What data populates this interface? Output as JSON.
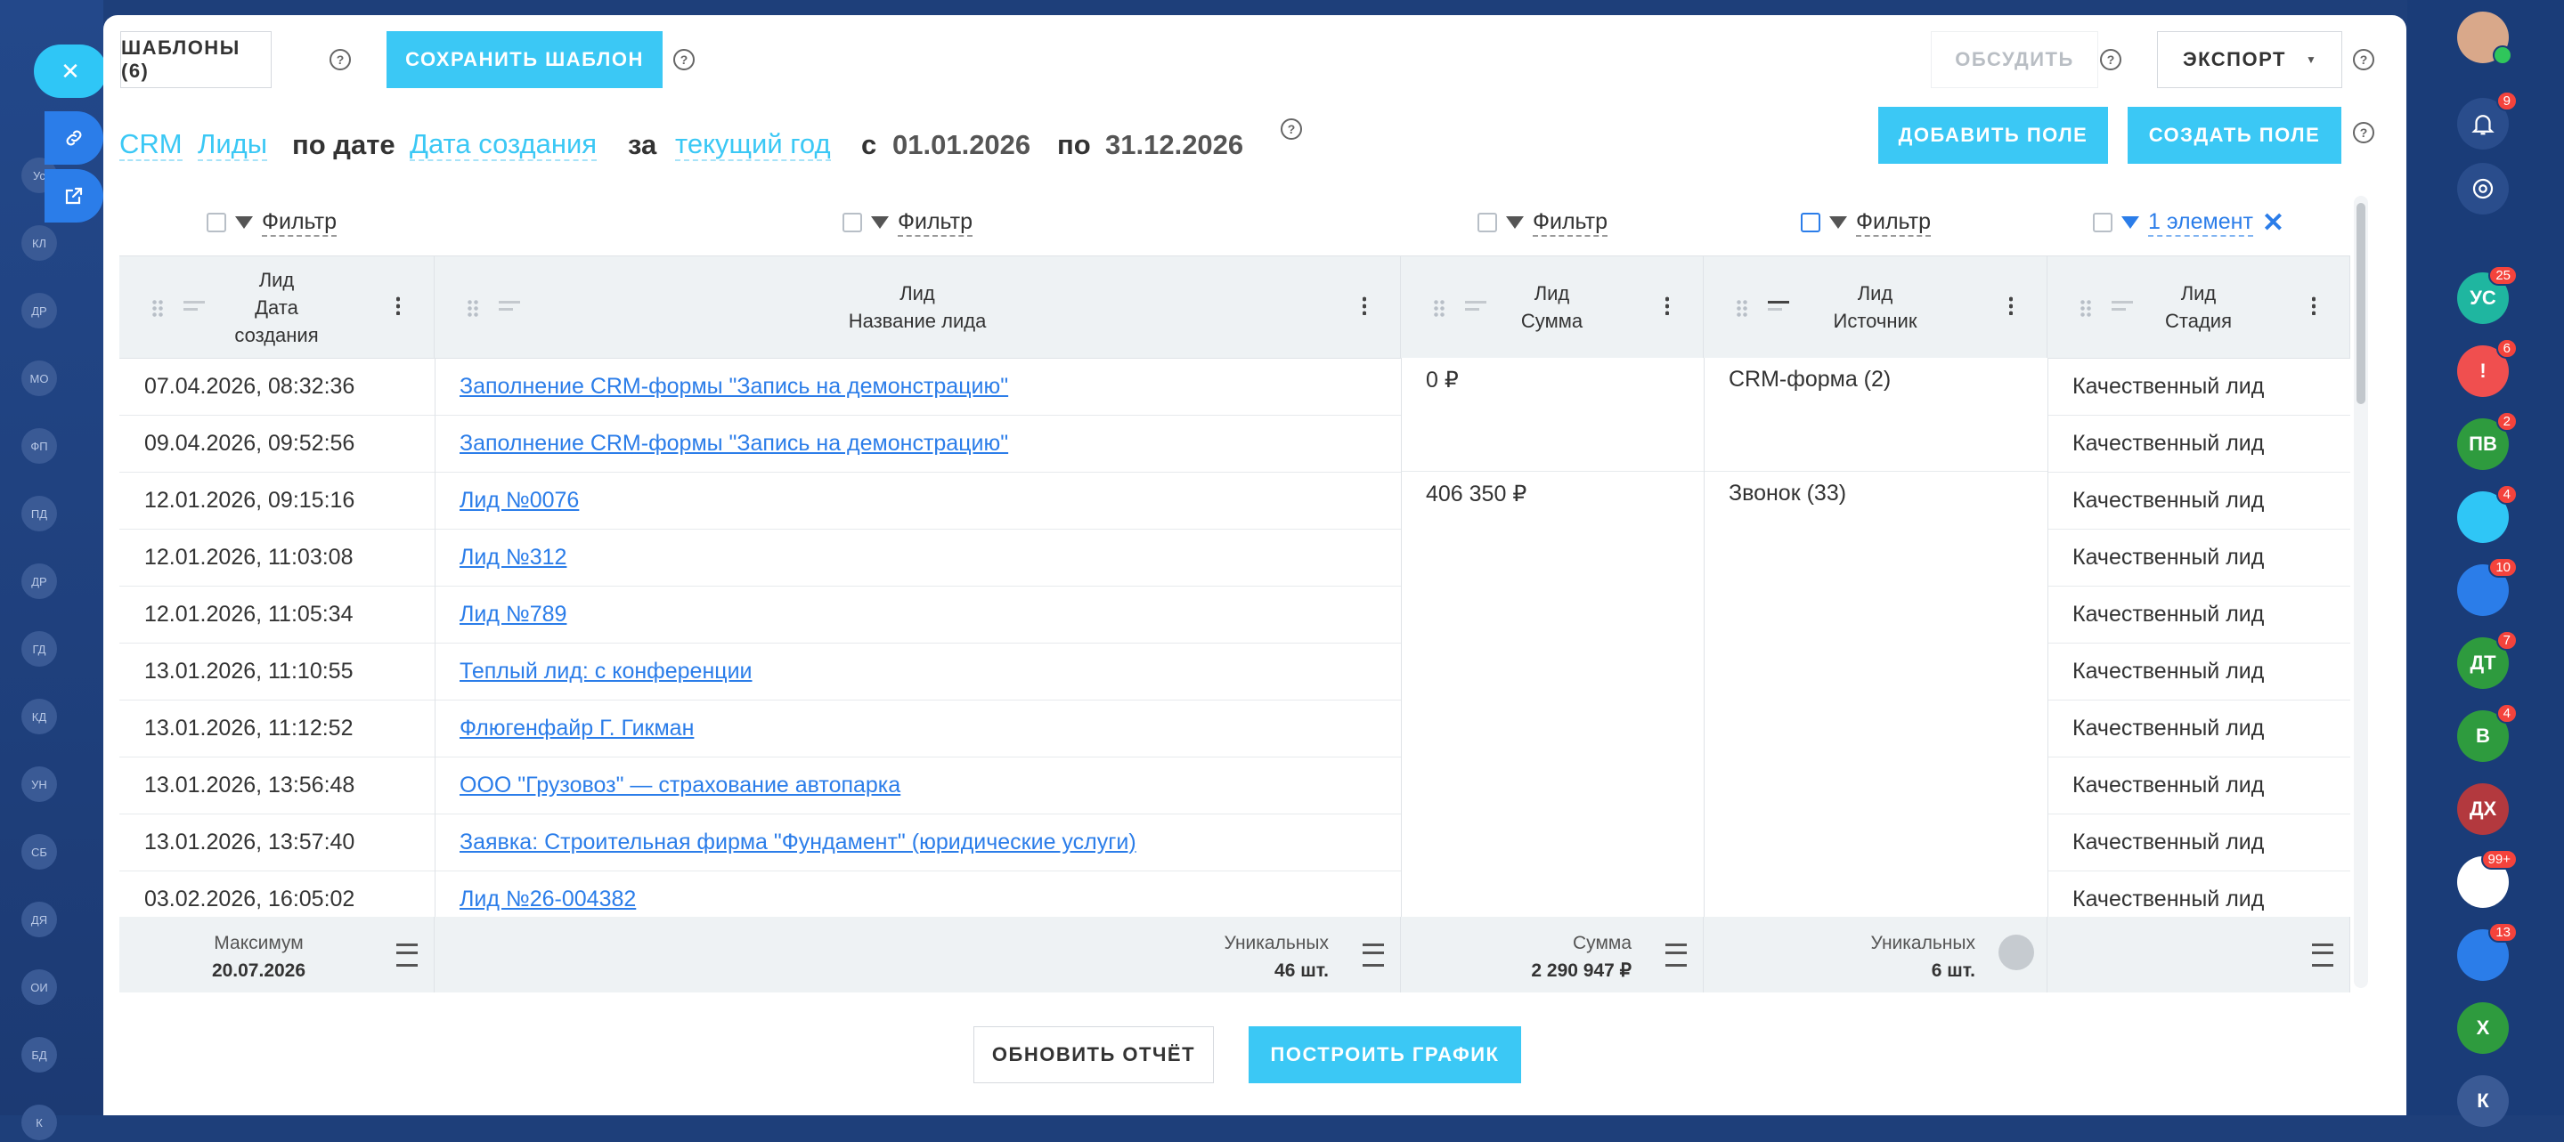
{
  "toolbar": {
    "templates_label": "ШАБЛОНЫ (6)",
    "save_template_label": "СОХРАНИТЬ ШАБЛОН",
    "discuss_label": "ОБСУДИТЬ",
    "export_label": "ЭКСПОРТ"
  },
  "breadcrumb": {
    "crm": "CRM",
    "leads": "Лиды",
    "by_date": "по дате",
    "date_field": "Дата создания",
    "for": "за",
    "period": "текущий год",
    "from": "с",
    "date_from": "01.01.2026",
    "to": "по",
    "date_to": "31.12.2026"
  },
  "actions": {
    "add_field": "ДОБАВИТЬ ПОЛЕ",
    "create_field": "СОЗДАТЬ ПОЛЕ"
  },
  "filters": {
    "filter_label": "Фильтр",
    "active_label": "1 элемент",
    "clear": "✕"
  },
  "columns": [
    {
      "line1": "Лид",
      "line2": "Дата",
      "line3": "создания"
    },
    {
      "line1": "Лид",
      "line2": "Название лида"
    },
    {
      "line1": "Лид",
      "line2": "Сумма"
    },
    {
      "line1": "Лид",
      "line2": "Источник"
    },
    {
      "line1": "Лид",
      "line2": "Стадия"
    }
  ],
  "rows": [
    {
      "date": "07.04.2026, 08:32:36",
      "name": "Заполнение CRM-формы \"Запись на демонстрацию\"",
      "stage": "Качественный лид"
    },
    {
      "date": "09.04.2026, 09:52:56",
      "name": "Заполнение CRM-формы \"Запись на демонстрацию\"",
      "stage": "Качественный лид"
    },
    {
      "date": "12.01.2026, 09:15:16",
      "name": "Лид №0076",
      "stage": "Качественный лид"
    },
    {
      "date": "12.01.2026, 11:03:08",
      "name": "Лид №312",
      "stage": "Качественный лид"
    },
    {
      "date": "12.01.2026, 11:05:34",
      "name": "Лид №789",
      "stage": "Качественный лид"
    },
    {
      "date": "13.01.2026, 11:10:55",
      "name": "Теплый лид: с конференции",
      "stage": "Качественный лид"
    },
    {
      "date": "13.01.2026, 11:12:52",
      "name": "Флюгенфайр Г. Гикман",
      "stage": "Качественный лид"
    },
    {
      "date": "13.01.2026, 13:56:48",
      "name": "ООО \"Грузовоз\" — страхование автопарка",
      "stage": "Качественный лид"
    },
    {
      "date": "13.01.2026, 13:57:40",
      "name": "Заявка: Строительная фирма \"Фундамент\" (юридические услуги)",
      "stage": "Качественный лид"
    },
    {
      "date": "03.02.2026, 16:05:02",
      "name": "Лид №26-004382",
      "stage": "Качественный лид"
    }
  ],
  "groups": {
    "sum1": "0 ₽",
    "source1": "CRM-форма (2)",
    "sum2": "406 350 ₽",
    "source2": "Звонок (33)"
  },
  "footer": [
    {
      "label": "Максимум",
      "value": "20.07.2026"
    },
    {
      "label": "Уникальных",
      "value": "46 шт."
    },
    {
      "label": "Сумма",
      "value": "2 290 947 ₽"
    },
    {
      "label": "Уникальных",
      "value": "6 шт."
    },
    {
      "label": "",
      "value": ""
    }
  ],
  "bottom": {
    "refresh": "ОБНОВИТЬ ОТЧЁТ",
    "build_chart": "ПОСТРОИТЬ ГРАФИК"
  },
  "background_left": [
    "Ус",
    "КЛ",
    "ДР",
    "МО",
    "ФП",
    "ПД",
    "ДР",
    "ГД",
    "КД",
    "УН",
    "СБ",
    "ДЯ",
    "ОИ",
    "БД",
    "К"
  ],
  "right_bar": [
    {
      "label": "УС",
      "badge": "25",
      "color": "#1fb6a0"
    },
    {
      "label": "!",
      "badge": "6",
      "color": "#f04f4f"
    },
    {
      "label": "ПВ",
      "badge": "2",
      "color": "#2e9b3e"
    },
    {
      "label": "",
      "badge": "4",
      "color": "#2fc6f6"
    },
    {
      "label": "",
      "badge": "10",
      "color": "#2b7de9"
    },
    {
      "label": "ДТ",
      "badge": "7",
      "color": "#2e9b3e"
    },
    {
      "label": "В",
      "badge": "4",
      "color": "#2e9b3e"
    },
    {
      "label": "ДХ",
      "badge": "",
      "color": "#b3393e"
    },
    {
      "label": "",
      "badge": "99+",
      "color": "#ffffff"
    },
    {
      "label": "",
      "badge": "13",
      "color": "#2b7de9"
    },
    {
      "label": "Х",
      "badge": "",
      "color": "#2e9b3e"
    },
    {
      "label": "К",
      "badge": "",
      "color": "#3a5a95"
    }
  ],
  "notifications": {
    "badge": "9"
  }
}
